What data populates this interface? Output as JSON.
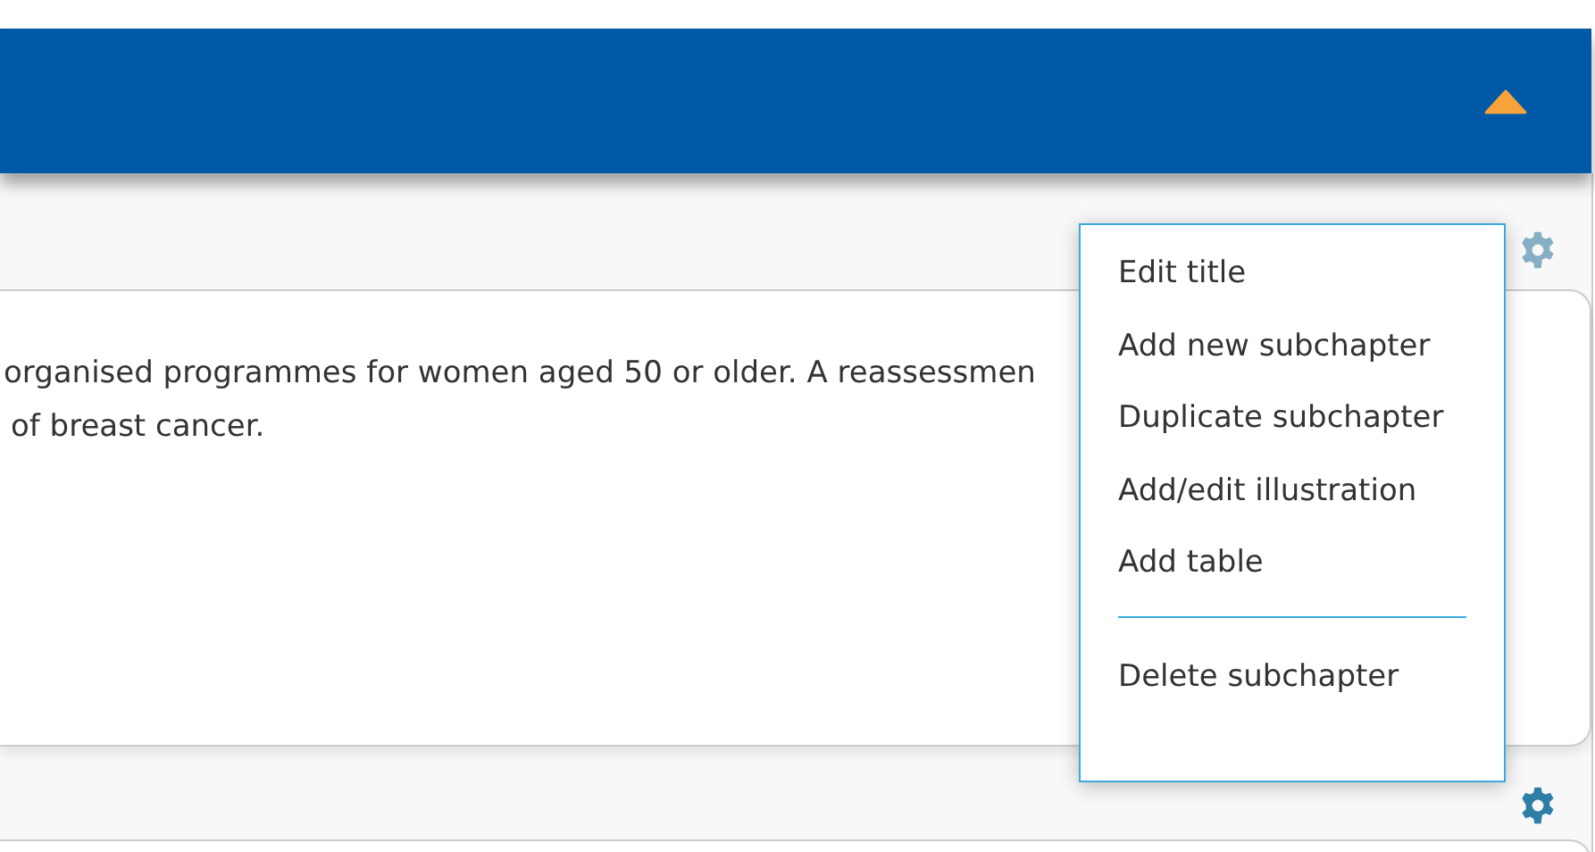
{
  "header": {
    "expanded": true
  },
  "sections": [
    {
      "menu_open": true,
      "lines": [
        "organised programmes for women aged 50 or older. A reassessmen",
        "of breast cancer."
      ]
    },
    {
      "menu_open": false
    }
  ],
  "menu": {
    "items": [
      {
        "label": "Edit title",
        "kind": "item"
      },
      {
        "label": "Add new subchapter",
        "kind": "item"
      },
      {
        "label": "Duplicate subchapter",
        "kind": "item"
      },
      {
        "label": "Add/edit illustration",
        "kind": "item"
      },
      {
        "label": "Add table",
        "kind": "item"
      },
      {
        "kind": "divider"
      },
      {
        "label": "Delete subchapter",
        "kind": "item"
      }
    ]
  }
}
